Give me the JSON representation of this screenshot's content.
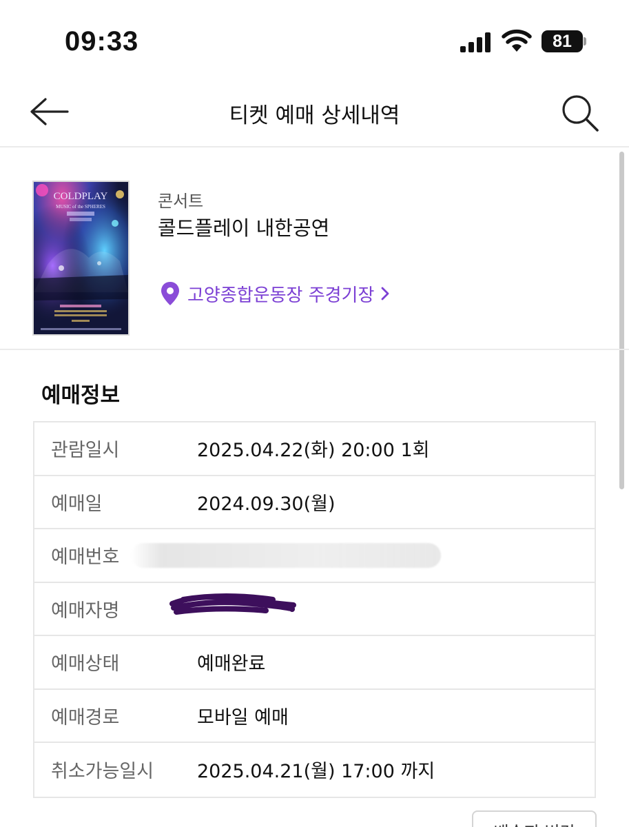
{
  "status_bar": {
    "time": "09:33",
    "battery": "81"
  },
  "header": {
    "title": "티켓 예매 상세내역",
    "back_icon": "arrow-left-icon",
    "search_icon": "search-icon"
  },
  "event": {
    "category": "콘서트",
    "name": "콜드플레이 내한공연",
    "venue": "고양종합운동장 주경기장",
    "poster": {
      "headline": "COLDPLAY",
      "subtitle": "MUSIC of the SPHERES"
    }
  },
  "booking_info": {
    "title": "예매정보",
    "rows": [
      {
        "label": "관람일시",
        "value": "2025.04.22(화) 20:00 1회"
      },
      {
        "label": "예매일",
        "value": "2024.09.30(월)"
      },
      {
        "label": "예매번호",
        "value": ""
      },
      {
        "label": "예매자명",
        "value": ""
      },
      {
        "label": "예매상태",
        "value": "예매완료"
      },
      {
        "label": "예매경로",
        "value": "모바일 예매"
      },
      {
        "label": "취소가능일시",
        "value": "2025.04.21(월) 17:00 까지"
      }
    ]
  },
  "footer": {
    "delivery_button": "배송지 변경"
  },
  "colors": {
    "accent": "#7b3fd4",
    "scribble": "#3d0f5c"
  }
}
